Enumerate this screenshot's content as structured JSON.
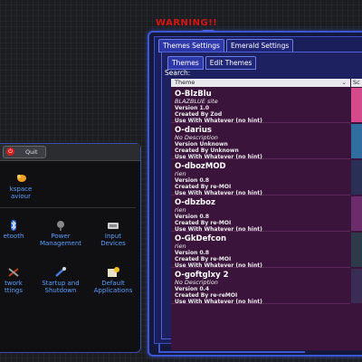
{
  "warning_title": "WARNING!!",
  "window": {
    "top_tabs": [
      "Themes Settings",
      "Emerald Settings"
    ],
    "inner_tabs": [
      "Themes",
      "Edit Themes"
    ],
    "search_label": "Search:",
    "columns": [
      "Theme",
      "Sc"
    ],
    "sort_icon": "chevron-down-icon",
    "themes": [
      {
        "name": "O-BlzBlu",
        "description": "BLAZBLUE site",
        "version": "Version 1.0",
        "author": "Created By Zod",
        "usage": "Use With Whatever (no hint)",
        "thumb_color": "#d44a8a"
      },
      {
        "name": "O-darius",
        "description": "No Description",
        "version": "Version Unknown",
        "author": "Created By Unknown",
        "usage": "Use With Whatever (no hint)",
        "thumb_color": "#2f6e9e"
      },
      {
        "name": "O-dbozMOD",
        "description": "rien",
        "version": "Version 0.8",
        "author": "Created By re-MOI",
        "usage": "Use With Whatever (no hint)",
        "thumb_color": "#2a2f55"
      },
      {
        "name": "O-dbzboz",
        "description": "rien",
        "version": "Version 0.8",
        "author": "Created By re-MOI",
        "usage": "Use With Whatever (no hint)",
        "thumb_color": "#6a2c6a"
      },
      {
        "name": "O-GkDefcon",
        "description": "rien",
        "version": "Version 0.8",
        "author": "Created By re-MOI",
        "usage": "Use With Whatever (no hint)",
        "thumb_color": "#2c3a4a"
      },
      {
        "name": "O-goftglxy 2",
        "description": "No Description",
        "version": "Version 0.4",
        "author": "Created By re-reMOI",
        "usage": "Use With Whatever (no hint)",
        "thumb_color": "#3a2d55"
      }
    ]
  },
  "left_panel": {
    "quit_label": "Quit",
    "items": [
      {
        "label": "kspace\naviour",
        "icon": "workspace-icon"
      },
      {
        "label": "etooth",
        "icon": "bluetooth-icon"
      },
      {
        "label": "Power\nManagement",
        "icon": "power-management-icon"
      },
      {
        "label": "Input\nDevices",
        "icon": "input-devices-icon"
      },
      {
        "label": "twork\nttings",
        "icon": "network-icon"
      },
      {
        "label": "Startup and\nShutdown",
        "icon": "startup-icon"
      },
      {
        "label": "Default\nApplications",
        "icon": "default-applications-icon"
      }
    ]
  },
  "colors": {
    "accent": "#3c57d6",
    "warning": "#d81414",
    "list_bg": "#3b143c",
    "link_text": "#5aa0ff"
  }
}
